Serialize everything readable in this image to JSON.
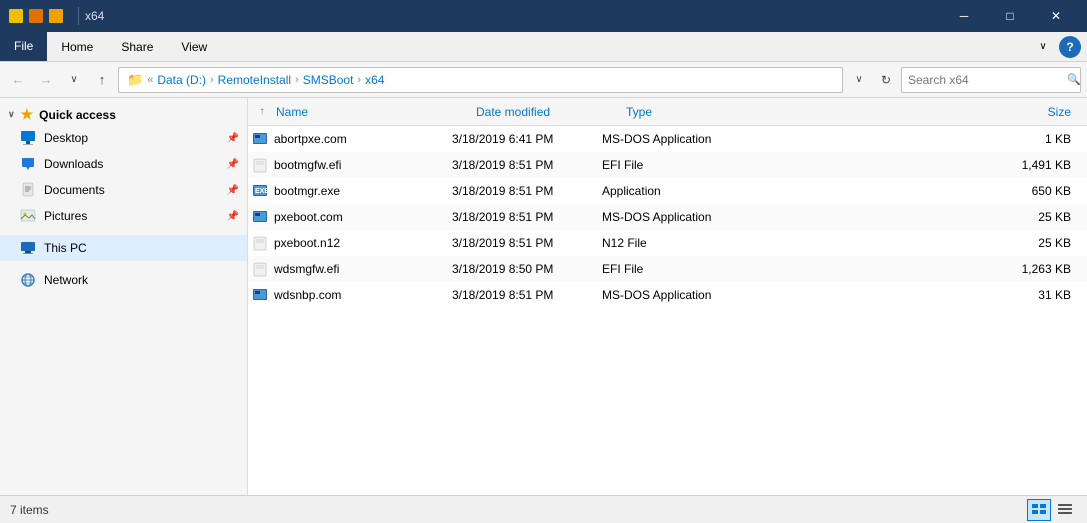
{
  "titleBar": {
    "title": "x64",
    "minimizeLabel": "─",
    "restoreLabel": "□",
    "closeLabel": "✕"
  },
  "menuBar": {
    "items": [
      "File",
      "Home",
      "Share",
      "View"
    ],
    "activeItem": "File",
    "helpLabel": "?"
  },
  "addressBar": {
    "back": "←",
    "forward": "→",
    "dropdownArrow": "∨",
    "up": "↑",
    "pathParts": [
      "Data (D:)",
      "RemoteInstall",
      "SMSBoot",
      "x64"
    ],
    "pathSeparator": "›",
    "refresh": "↻",
    "searchPlaceholder": "Search x64",
    "searchIcon": "🔍"
  },
  "sidebar": {
    "quickAccess": {
      "label": "Quick access",
      "arrow": "∨"
    },
    "items": [
      {
        "name": "Desktop",
        "pinned": true,
        "type": "folder"
      },
      {
        "name": "Downloads",
        "pinned": true,
        "type": "download"
      },
      {
        "name": "Documents",
        "pinned": true,
        "type": "doc"
      },
      {
        "name": "Pictures",
        "pinned": true,
        "type": "pic"
      }
    ],
    "thisPC": {
      "label": "This PC"
    },
    "network": {
      "label": "Network"
    }
  },
  "fileList": {
    "columns": [
      "Name",
      "Date modified",
      "Type",
      "Size"
    ],
    "sortArrow": "↑",
    "files": [
      {
        "name": "abortpxe.com",
        "dateModified": "3/18/2019 6:41 PM",
        "type": "MS-DOS Application",
        "size": "1 KB",
        "iconType": "com"
      },
      {
        "name": "bootmgfw.efi",
        "dateModified": "3/18/2019 8:51 PM",
        "type": "EFI File",
        "size": "1,491 KB",
        "iconType": "efi"
      },
      {
        "name": "bootmgr.exe",
        "dateModified": "3/18/2019 8:51 PM",
        "type": "Application",
        "size": "650 KB",
        "iconType": "exe"
      },
      {
        "name": "pxeboot.com",
        "dateModified": "3/18/2019 8:51 PM",
        "type": "MS-DOS Application",
        "size": "25 KB",
        "iconType": "com"
      },
      {
        "name": "pxeboot.n12",
        "dateModified": "3/18/2019 8:51 PM",
        "type": "N12 File",
        "size": "25 KB",
        "iconType": "efi"
      },
      {
        "name": "wdsmgfw.efi",
        "dateModified": "3/18/2019 8:50 PM",
        "type": "EFI File",
        "size": "1,263 KB",
        "iconType": "efi"
      },
      {
        "name": "wdsnbp.com",
        "dateModified": "3/18/2019 8:51 PM",
        "type": "MS-DOS Application",
        "size": "31 KB",
        "iconType": "com"
      }
    ]
  },
  "statusBar": {
    "itemCount": "7 items"
  }
}
